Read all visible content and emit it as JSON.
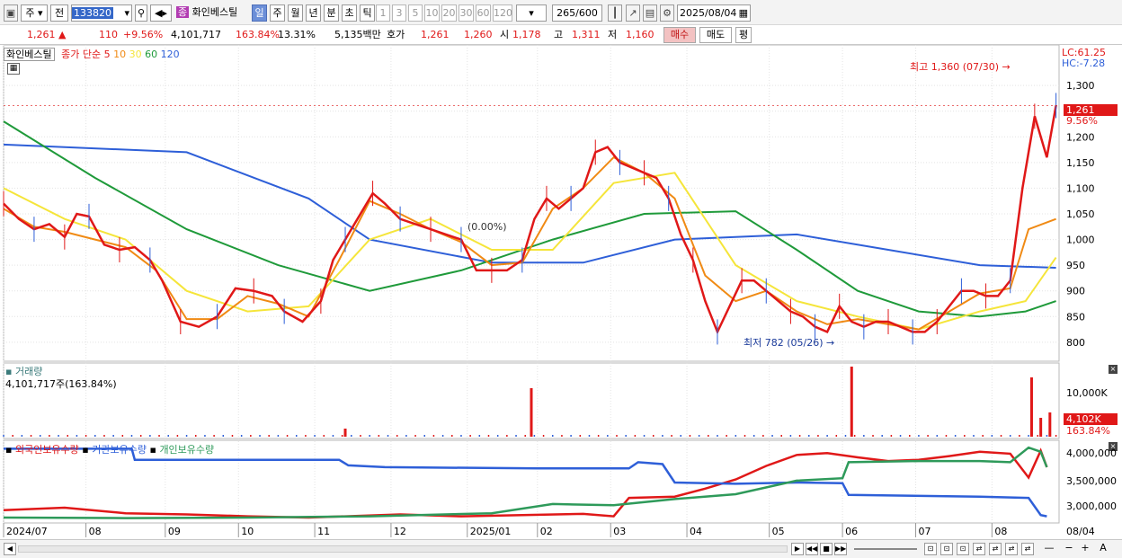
{
  "toolbar": {
    "market": "주",
    "prev": "전",
    "code": "133820",
    "name_chip": "종",
    "stock_name": "화인베스틸",
    "periods": [
      "일",
      "주",
      "월",
      "년",
      "분",
      "초",
      "틱"
    ],
    "active_period": "일",
    "minutes": [
      "1",
      "3",
      "5",
      "10",
      "20",
      "30",
      "60",
      "120"
    ],
    "count": "265",
    "count_total": "/600",
    "date": "2025/08/04"
  },
  "quote": {
    "price": "1,261 ▲",
    "change": "110",
    "rate": "+9.56%",
    "volume": "4,101,717",
    "vol_ratio": "163.84%",
    "turnover": "13.31%",
    "amount": "5,135백만",
    "hoga_label": "호가",
    "hoga_ask": "1,261",
    "hoga_bid": "1,260",
    "open_label": "시",
    "open": "1,178",
    "high_label": "고",
    "high": "1,311",
    "low_label": "저",
    "low": "1,160",
    "buy_label": "매수",
    "sell_label": "매도",
    "avg_label": "평"
  },
  "price_panel": {
    "stock_label": "화인베스틸",
    "ma_title": "종가 단순",
    "ma_periods": [
      "5",
      "10",
      "30",
      "60",
      "120"
    ],
    "ma_colors": [
      "#e01818",
      "#f08a14",
      "#f5e53a",
      "#1f9a3a",
      "#2e5fd8"
    ],
    "lc": "LC:61.25",
    "hc": "HC:-7.28",
    "y_ticks": [
      "1,300",
      "1,250",
      "1,200",
      "1,150",
      "1,100",
      "1,050",
      "1,000",
      "950",
      "900",
      "850",
      "800"
    ],
    "price_badge": "1,261",
    "price_badge_pct": "9.56%",
    "high_note": "최고 1,360 (07/30)",
    "low_note": "최저 782 (05/26)",
    "mid_note": "(0.00%)"
  },
  "volume_panel": {
    "title": "거래량",
    "value": "4,101,717주(163.84%)",
    "y_tick": "10,000K",
    "badge": "4,102K",
    "badge_pct": "163.84%"
  },
  "holding_panel": {
    "legend": [
      "외국인보유수량",
      "기관보유수량",
      "개인보유수량"
    ],
    "colors": [
      "#e01818",
      "#2e5fd8",
      "#2e9a5a"
    ],
    "y_ticks": [
      "4,000,000",
      "3,500,000",
      "3,000,000"
    ]
  },
  "x_axis": {
    "labels": [
      "2024/07",
      "08",
      "09",
      "10",
      "11",
      "12",
      "2025/01",
      "02",
      "03",
      "04",
      "05",
      "06",
      "07",
      "08"
    ],
    "right_label": "08/04"
  },
  "chart_data": {
    "type": "line",
    "title": "",
    "ylim": [
      770,
      1365
    ],
    "ma5": [
      [
        0,
        1070
      ],
      [
        5,
        1040
      ],
      [
        10,
        1020
      ],
      [
        15,
        1030
      ],
      [
        20,
        1005
      ],
      [
        24,
        1050
      ],
      [
        28,
        1045
      ],
      [
        33,
        990
      ],
      [
        38,
        980
      ],
      [
        43,
        985
      ],
      [
        48,
        960
      ],
      [
        52,
        920
      ],
      [
        58,
        840
      ],
      [
        64,
        830
      ],
      [
        70,
        850
      ],
      [
        76,
        905
      ],
      [
        82,
        900
      ],
      [
        88,
        890
      ],
      [
        92,
        860
      ],
      [
        98,
        840
      ],
      [
        104,
        880
      ],
      [
        108,
        960
      ],
      [
        112,
        1000
      ],
      [
        116,
        1040
      ],
      [
        121,
        1090
      ],
      [
        125,
        1070
      ],
      [
        130,
        1040
      ],
      [
        135,
        1030
      ],
      [
        140,
        1020
      ],
      [
        145,
        1010
      ],
      [
        150,
        1000
      ],
      [
        155,
        940
      ],
      [
        160,
        940
      ],
      [
        165,
        940
      ],
      [
        170,
        960
      ],
      [
        174,
        1040
      ],
      [
        178,
        1080
      ],
      [
        182,
        1060
      ],
      [
        186,
        1080
      ],
      [
        190,
        1100
      ],
      [
        194,
        1170
      ],
      [
        198,
        1180
      ],
      [
        202,
        1150
      ],
      [
        206,
        1140
      ],
      [
        210,
        1130
      ],
      [
        214,
        1120
      ],
      [
        218,
        1080
      ],
      [
        222,
        1010
      ],
      [
        226,
        960
      ],
      [
        230,
        880
      ],
      [
        234,
        820
      ],
      [
        238,
        870
      ],
      [
        242,
        920
      ],
      [
        246,
        920
      ],
      [
        250,
        900
      ],
      [
        254,
        880
      ],
      [
        258,
        860
      ],
      [
        262,
        850
      ],
      [
        266,
        830
      ],
      [
        270,
        820
      ],
      [
        274,
        870
      ],
      [
        278,
        840
      ],
      [
        282,
        830
      ],
      [
        286,
        840
      ],
      [
        290,
        840
      ],
      [
        294,
        830
      ],
      [
        298,
        820
      ],
      [
        302,
        820
      ],
      [
        306,
        840
      ],
      [
        310,
        870
      ],
      [
        314,
        900
      ],
      [
        318,
        900
      ],
      [
        322,
        890
      ],
      [
        326,
        890
      ],
      [
        330,
        920
      ],
      [
        334,
        1100
      ],
      [
        338,
        1240
      ],
      [
        342,
        1160
      ],
      [
        345,
        1261
      ]
    ],
    "ma10": [
      [
        0,
        1060
      ],
      [
        10,
        1025
      ],
      [
        20,
        1015
      ],
      [
        30,
        1000
      ],
      [
        40,
        985
      ],
      [
        50,
        940
      ],
      [
        60,
        845
      ],
      [
        70,
        845
      ],
      [
        80,
        890
      ],
      [
        90,
        875
      ],
      [
        100,
        850
      ],
      [
        110,
        960
      ],
      [
        120,
        1075
      ],
      [
        130,
        1050
      ],
      [
        140,
        1020
      ],
      [
        150,
        995
      ],
      [
        160,
        950
      ],
      [
        170,
        955
      ],
      [
        180,
        1060
      ],
      [
        190,
        1100
      ],
      [
        200,
        1160
      ],
      [
        210,
        1130
      ],
      [
        220,
        1080
      ],
      [
        230,
        930
      ],
      [
        240,
        880
      ],
      [
        250,
        900
      ],
      [
        260,
        860
      ],
      [
        270,
        835
      ],
      [
        280,
        845
      ],
      [
        290,
        835
      ],
      [
        300,
        825
      ],
      [
        310,
        860
      ],
      [
        320,
        895
      ],
      [
        330,
        905
      ],
      [
        336,
        1020
      ],
      [
        345,
        1040
      ]
    ],
    "ma30": [
      [
        0,
        1100
      ],
      [
        20,
        1040
      ],
      [
        40,
        1000
      ],
      [
        60,
        900
      ],
      [
        80,
        860
      ],
      [
        100,
        870
      ],
      [
        120,
        1000
      ],
      [
        140,
        1040
      ],
      [
        160,
        980
      ],
      [
        180,
        980
      ],
      [
        200,
        1110
      ],
      [
        220,
        1130
      ],
      [
        240,
        950
      ],
      [
        260,
        880
      ],
      [
        280,
        850
      ],
      [
        300,
        825
      ],
      [
        320,
        860
      ],
      [
        335,
        880
      ],
      [
        345,
        965
      ]
    ],
    "ma60": [
      [
        0,
        1230
      ],
      [
        30,
        1120
      ],
      [
        60,
        1020
      ],
      [
        90,
        950
      ],
      [
        120,
        900
      ],
      [
        150,
        940
      ],
      [
        180,
        1000
      ],
      [
        210,
        1050
      ],
      [
        240,
        1055
      ],
      [
        260,
        980
      ],
      [
        280,
        900
      ],
      [
        300,
        860
      ],
      [
        320,
        850
      ],
      [
        335,
        860
      ],
      [
        345,
        880
      ]
    ],
    "ma120": [
      [
        0,
        1185
      ],
      [
        60,
        1170
      ],
      [
        100,
        1080
      ],
      [
        120,
        1000
      ],
      [
        160,
        955
      ],
      [
        190,
        955
      ],
      [
        220,
        1000
      ],
      [
        260,
        1010
      ],
      [
        290,
        980
      ],
      [
        320,
        950
      ],
      [
        345,
        945
      ]
    ],
    "volume_spikes": [
      [
        112,
        0.15
      ],
      [
        173,
        0.9
      ],
      [
        278,
        1.3
      ],
      [
        337,
        1.1
      ],
      [
        340,
        0.35
      ],
      [
        343,
        0.45
      ]
    ],
    "foreign_hold": [
      [
        0,
        3.0
      ],
      [
        20,
        3.04
      ],
      [
        40,
        2.95
      ],
      [
        60,
        2.93
      ],
      [
        80,
        2.9
      ],
      [
        100,
        2.88
      ],
      [
        130,
        2.93
      ],
      [
        150,
        2.9
      ],
      [
        170,
        2.92
      ],
      [
        190,
        2.94
      ],
      [
        200,
        2.9
      ],
      [
        205,
        3.2
      ],
      [
        220,
        3.22
      ],
      [
        230,
        3.35
      ],
      [
        240,
        3.5
      ],
      [
        250,
        3.72
      ],
      [
        260,
        3.9
      ],
      [
        270,
        3.93
      ],
      [
        280,
        3.86
      ],
      [
        290,
        3.8
      ],
      [
        300,
        3.82
      ],
      [
        310,
        3.88
      ],
      [
        320,
        3.95
      ],
      [
        330,
        3.92
      ],
      [
        336,
        3.53
      ],
      [
        340,
        3.97
      ],
      [
        342,
        3.7
      ]
    ],
    "inst_hold": [
      [
        0,
        4.0
      ],
      [
        42,
        4.0
      ],
      [
        43,
        3.82
      ],
      [
        110,
        3.82
      ],
      [
        113,
        3.73
      ],
      [
        125,
        3.7
      ],
      [
        175,
        3.68
      ],
      [
        205,
        3.68
      ],
      [
        208,
        3.78
      ],
      [
        216,
        3.75
      ],
      [
        220,
        3.45
      ],
      [
        240,
        3.43
      ],
      [
        260,
        3.45
      ],
      [
        275,
        3.44
      ],
      [
        277,
        3.25
      ],
      [
        320,
        3.22
      ],
      [
        336,
        3.2
      ],
      [
        340,
        2.92
      ],
      [
        342,
        2.9
      ]
    ],
    "indiv_hold": [
      [
        0,
        2.88
      ],
      [
        40,
        2.87
      ],
      [
        80,
        2.88
      ],
      [
        120,
        2.9
      ],
      [
        160,
        2.95
      ],
      [
        180,
        3.1
      ],
      [
        200,
        3.08
      ],
      [
        220,
        3.18
      ],
      [
        240,
        3.26
      ],
      [
        260,
        3.48
      ],
      [
        275,
        3.52
      ],
      [
        277,
        3.78
      ],
      [
        300,
        3.8
      ],
      [
        320,
        3.8
      ],
      [
        330,
        3.78
      ],
      [
        336,
        4.02
      ],
      [
        340,
        3.95
      ],
      [
        342,
        3.7
      ]
    ]
  }
}
